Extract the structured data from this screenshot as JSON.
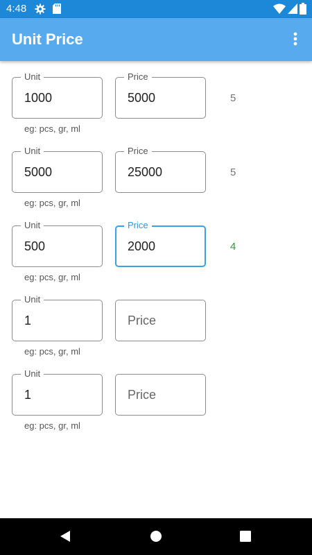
{
  "status_bar": {
    "time": "4:48"
  },
  "app_bar": {
    "title": "Unit Price"
  },
  "labels": {
    "unit": "Unit",
    "price": "Price",
    "helper": "eg: pcs, gr, ml"
  },
  "rows": [
    {
      "unit": "1000",
      "price": "5000",
      "price_placeholder": "",
      "result": "5"
    },
    {
      "unit": "5000",
      "price": "25000",
      "price_placeholder": "",
      "result": "5"
    },
    {
      "unit": "500",
      "price": "2000",
      "price_placeholder": "",
      "result": "4"
    },
    {
      "unit": "1",
      "price": "",
      "price_placeholder": "Price",
      "result": ""
    },
    {
      "unit": "1",
      "price": "",
      "price_placeholder": "Price",
      "result": ""
    }
  ],
  "colors": {
    "status_bar": "#1d87d8",
    "app_bar": "#58aaef",
    "focus": "#3aa1e4",
    "best_price": "#2e9b36"
  }
}
